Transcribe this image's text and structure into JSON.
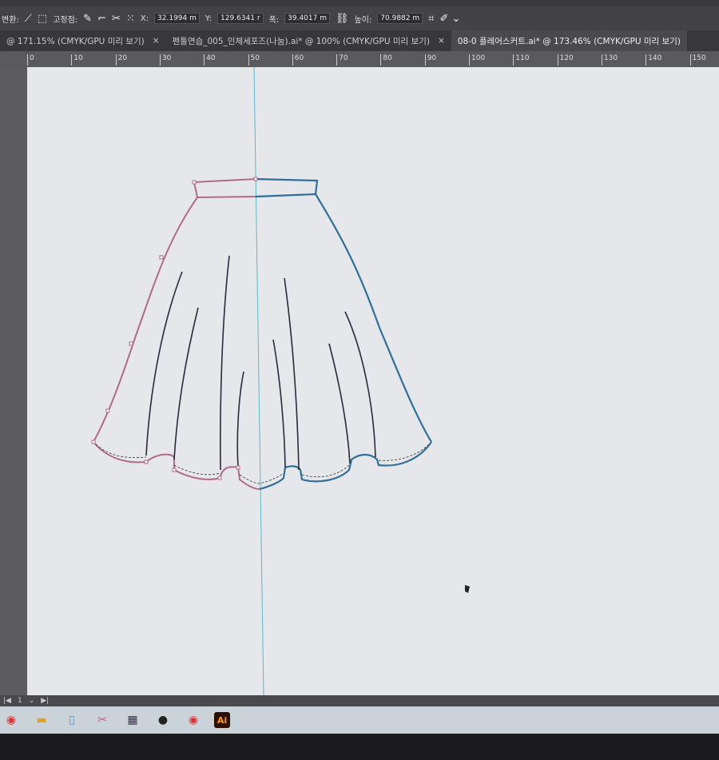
{
  "control_bar": {
    "convert_label": "변환:",
    "anchor_label": "고정점:",
    "x_label": "X:",
    "x_value": "32.1994 m",
    "y_label": "Y:",
    "y_value": "129.6341 r",
    "width_label": "폭:",
    "width_value": "39.4017 m",
    "height_label": "높이:",
    "height_value": "70.9882 m"
  },
  "tabs": [
    {
      "label": "@ 171.15% (CMYK/GPU 미리 보기)"
    },
    {
      "label": "펜툴연습_005_인체세포즈(나눔).ai* @ 100% (CMYK/GPU 미리 보기)"
    },
    {
      "label": "08-0 플레어스커트.ai* @ 173.46% (CMYK/GPU 미리 보기)"
    }
  ],
  "close_glyph": "×",
  "ruler_ticks": [
    "0",
    "10",
    "20",
    "30",
    "40",
    "50",
    "60",
    "70",
    "80",
    "90",
    "100",
    "110",
    "120",
    "130",
    "140",
    "150"
  ],
  "status": {
    "page": "1"
  },
  "taskbar": [
    "chrome-icon",
    "file-explorer-icon",
    "app-icon",
    "paint-icon",
    "calculator-icon",
    "obs-icon",
    "chrome-icon",
    "illustrator-icon"
  ],
  "taskbar_ai_label": "Ai",
  "colors": {
    "path_left": "#b06a8a",
    "path_right": "#2f6f9a",
    "guide": "#5ab8c8"
  }
}
